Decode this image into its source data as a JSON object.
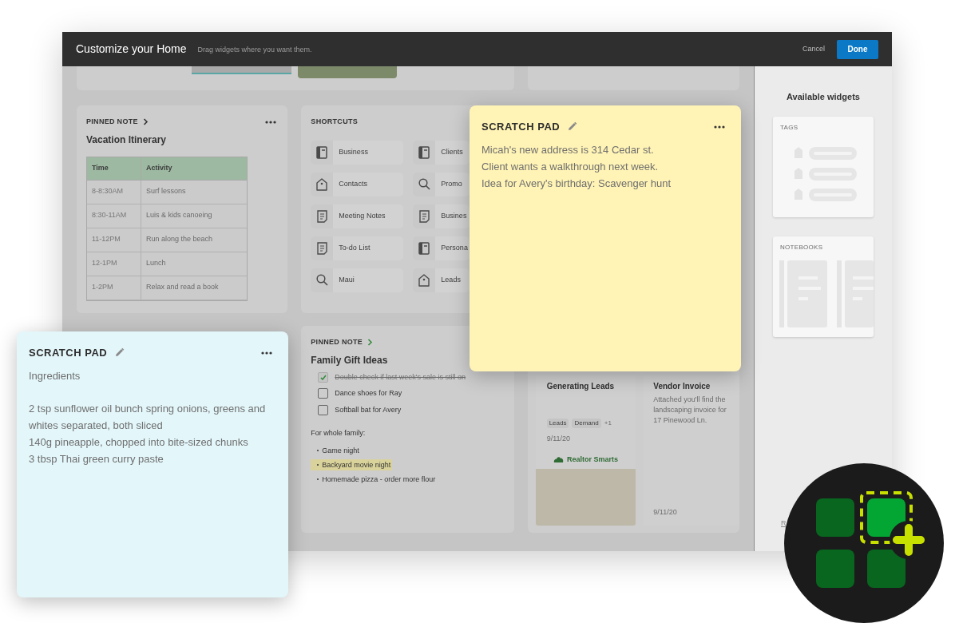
{
  "header": {
    "title": "Customize your Home",
    "subtitle": "Drag widgets where you want them.",
    "cancel": "Cancel",
    "done": "Done"
  },
  "vacation_card": {
    "label": "PINNED NOTE",
    "title": "Vacation Itinerary",
    "table": {
      "columns": [
        "Time",
        "Activity"
      ],
      "rows": [
        [
          "8-8:30AM",
          "Surf lessons"
        ],
        [
          "8:30-11AM",
          "Luis & kids canoeing"
        ],
        [
          "11-12PM",
          "Run along the beach"
        ],
        [
          "12-1PM",
          "Lunch"
        ],
        [
          "1-2PM",
          "Relax and read a book"
        ]
      ]
    }
  },
  "shortcuts": {
    "title": "SHORTCUTS",
    "items": [
      {
        "label": "Business",
        "kind": "notebook"
      },
      {
        "label": "Clients",
        "kind": "notebook"
      },
      {
        "label": "Contacts",
        "kind": "tag"
      },
      {
        "label": "Promo",
        "kind": "search"
      },
      {
        "label": "Meeting Notes",
        "kind": "note"
      },
      {
        "label": "Busines",
        "kind": "note"
      },
      {
        "label": "To-do List",
        "kind": "note"
      },
      {
        "label": "Persona",
        "kind": "notebook"
      },
      {
        "label": "Maui",
        "kind": "search"
      },
      {
        "label": "Leads",
        "kind": "tag"
      }
    ]
  },
  "family_card": {
    "label": "PINNED NOTE",
    "title": "Family Gift Ideas",
    "checklist": [
      {
        "text": "Double check if last week's sale is still on",
        "checked": true
      },
      {
        "text": "Dance shoes for Ray",
        "checked": false
      },
      {
        "text": "Softball bat for Avery",
        "checked": false
      }
    ],
    "subheading": "For whole family:",
    "bullets": [
      {
        "text": "Game night",
        "highlighted": false
      },
      {
        "text": "Backyard movie night",
        "highlighted": true
      },
      {
        "text": "Homemade pizza - order more flour",
        "highlighted": false
      }
    ]
  },
  "notes_card": {
    "notes": [
      {
        "kind": "tagged",
        "title": "Generating Leads",
        "tags": [
          "Leads",
          "Demand"
        ],
        "more": "+1",
        "date": "9/11/20",
        "brand": "Realtor Smarts"
      },
      {
        "kind": "text",
        "title": "Vendor Invoice",
        "body": "Attached you'll find the landscaping invoice for 17 Pinewood Ln.",
        "date": "9/11/20"
      }
    ]
  },
  "sidebar": {
    "title": "Available widgets",
    "widgets": [
      {
        "label": "TAGS",
        "kind": "tags"
      },
      {
        "label": "NOTEBOOKS",
        "kind": "notebooks"
      }
    ],
    "footer_link": "R"
  },
  "scratch_pads": [
    {
      "title": "SCRATCH PAD",
      "color": "#fff3b5",
      "paragraphs": [
        [
          "Micah's new address is 314 Cedar st.",
          "Client wants a walkthrough next week.",
          "Idea for Avery's birthday: Scavenger hunt"
        ]
      ]
    },
    {
      "title": "SCRATCH PAD",
      "color": "#e3f6fa",
      "paragraphs": [
        [
          "Ingredients"
        ],
        [
          "2 tsp sunflower oil bunch spring onions, greens and whites separated, both sliced",
          "140g pineapple, chopped into bite-sized chunks",
          "3 tbsp Thai green curry paste"
        ]
      ]
    }
  ]
}
